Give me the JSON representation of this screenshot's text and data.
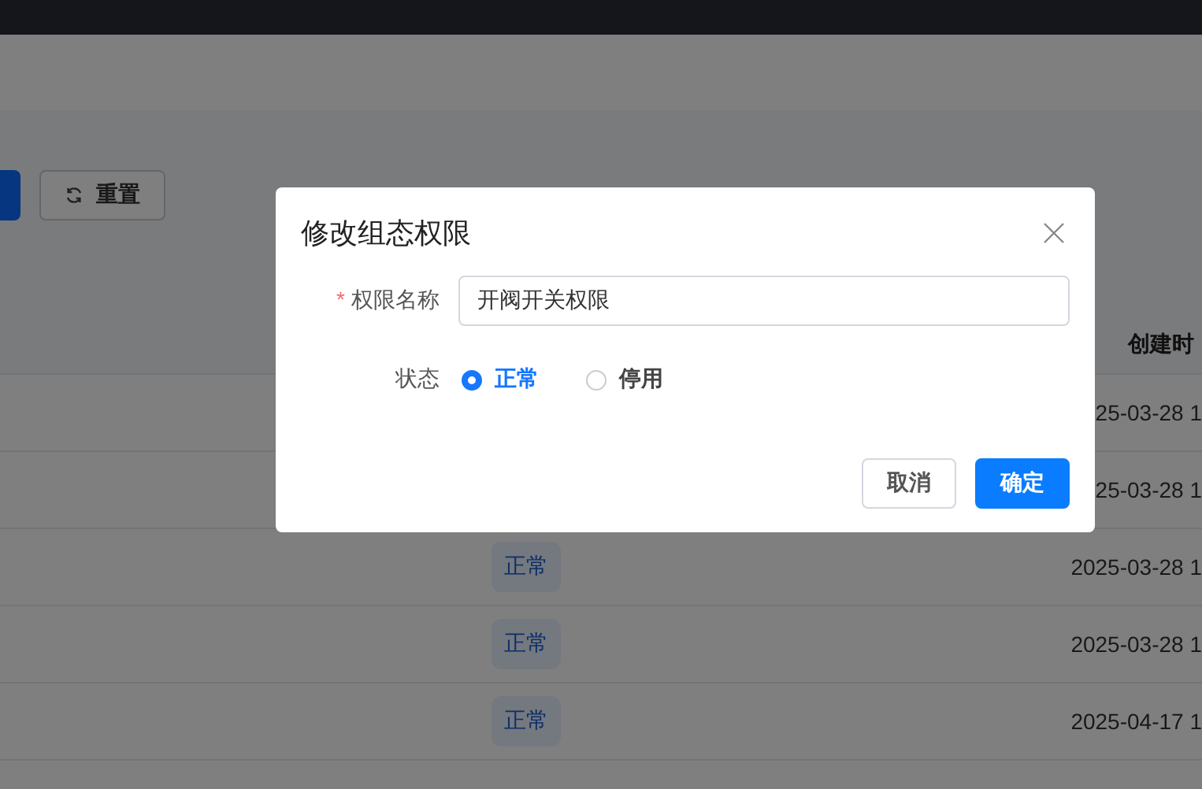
{
  "toolbar": {
    "reset_button": "重置"
  },
  "table": {
    "columns": [
      {
        "label": "创建时"
      }
    ],
    "rows": [
      {
        "created": "25-03-28 1"
      },
      {
        "created": "25-03-28 1"
      },
      {
        "status": "正常",
        "created": "2025-03-28 1"
      },
      {
        "status": "正常",
        "created": "2025-03-28 1"
      },
      {
        "status": "正常",
        "created": "2025-04-17 1"
      }
    ]
  },
  "dialog": {
    "title": "修改组态权限",
    "fields": [
      {
        "kind": "text",
        "label": "权限名称",
        "required_mark": "*",
        "value": "开阀开关权限"
      },
      {
        "kind": "radio",
        "label": "状态",
        "options": [
          {
            "label": "正常",
            "selected": true
          },
          {
            "label": "停用",
            "selected": false
          }
        ]
      }
    ],
    "buttons": [
      {
        "label": "取消",
        "primary": false
      },
      {
        "label": "确定",
        "primary": true
      }
    ]
  }
}
